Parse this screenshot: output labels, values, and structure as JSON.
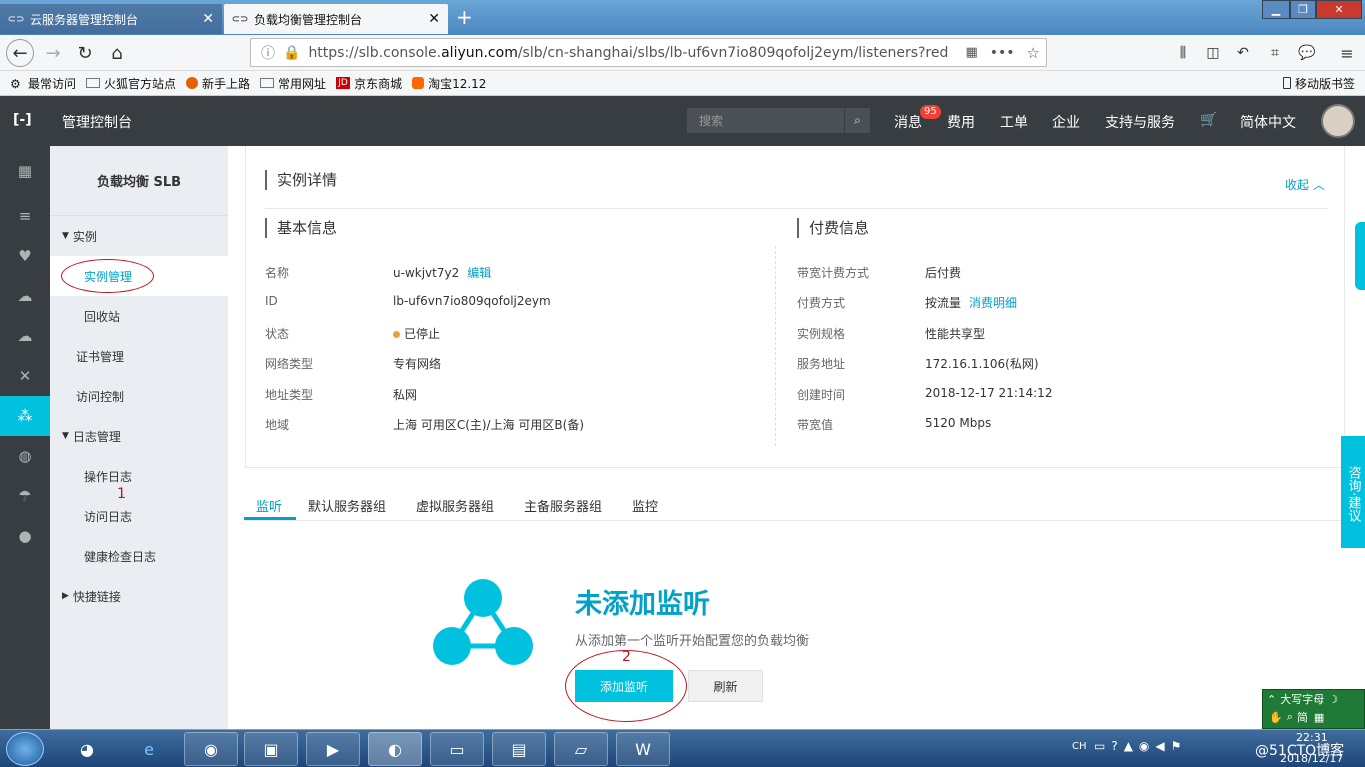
{
  "browser": {
    "tabs": [
      {
        "label": "云服务器管理控制台"
      },
      {
        "label": "负载均衡管理控制台"
      }
    ],
    "url_prefix": "https://slb.console.",
    "url_domain": "aliyun.com",
    "url_path": "/slb/cn-shanghai/slbs/lb-uf6vn7io809qofolj2eym/listeners?redire",
    "bookmarks": [
      "最常访问",
      "火狐官方站点",
      "新手上路",
      "常用网址",
      "京东商城",
      "淘宝12.12"
    ],
    "mobile_bookmarks": "移动版书签"
  },
  "header": {
    "title": "管理控制台",
    "search_placeholder": "搜索",
    "messages": "消息",
    "badge": "95",
    "menu": [
      "费用",
      "工单",
      "企业",
      "支持与服务"
    ],
    "language": "简体中文"
  },
  "sidebar": {
    "title": "负载均衡 SLB",
    "instance_group": "实例",
    "instance_manage": "实例管理",
    "recycle": "回收站",
    "cert": "证书管理",
    "access": "访问控制",
    "log_group": "日志管理",
    "op_log": "操作日志",
    "access_log": "访问日志",
    "health_log": "健康检查日志",
    "quicklinks": "快捷链接",
    "annotation_1": "1"
  },
  "detail": {
    "title": "实例详情",
    "collapse": "收起",
    "basic_title": "基本信息",
    "billing_title": "付费信息",
    "basic": [
      {
        "label": "名称",
        "value": "u-wkjvt7y2",
        "link": "编辑"
      },
      {
        "label": "ID",
        "value": "lb-uf6vn7io809qofolj2eym",
        "link": ""
      },
      {
        "label": "状态",
        "value": "已停止",
        "link": ""
      },
      {
        "label": "网络类型",
        "value": "专有网络",
        "link": ""
      },
      {
        "label": "地址类型",
        "value": "私网",
        "link": ""
      },
      {
        "label": "地域",
        "value": "上海 可用区C(主)/上海 可用区B(备)",
        "link": ""
      }
    ],
    "billing": [
      {
        "label": "带宽计费方式",
        "value": "后付费",
        "link": ""
      },
      {
        "label": "付费方式",
        "value": "按流量",
        "link": "消费明细"
      },
      {
        "label": "实例规格",
        "value": "性能共享型",
        "link": ""
      },
      {
        "label": "服务地址",
        "value": "172.16.1.106(私网)",
        "link": ""
      },
      {
        "label": "创建时间",
        "value": "2018-12-17 21:14:12",
        "link": ""
      },
      {
        "label": "带宽值",
        "value": "5120 Mbps",
        "link": ""
      }
    ]
  },
  "tabs": [
    "监听",
    "默认服务器组",
    "虚拟服务器组",
    "主备服务器组",
    "监控"
  ],
  "empty": {
    "title": "未添加监听",
    "desc": "从添加第一个监听开始配置您的负载均衡",
    "add_button": "添加监听",
    "refresh_button": "刷新",
    "annotation_2": "2"
  },
  "float": {
    "consult": "咨询·建议"
  },
  "ime": {
    "caps": "大写字母",
    "mode": "简"
  },
  "taskbar": {
    "lang": "CH",
    "time": "22:31",
    "date": "2018/12/17",
    "watermark": "@51CTO博客"
  },
  "colors": {
    "accent": "#00c1de",
    "header": "#373d41",
    "sidebar": "#eaedf1",
    "link": "#00a2ca",
    "annotation": "#c0141e"
  }
}
